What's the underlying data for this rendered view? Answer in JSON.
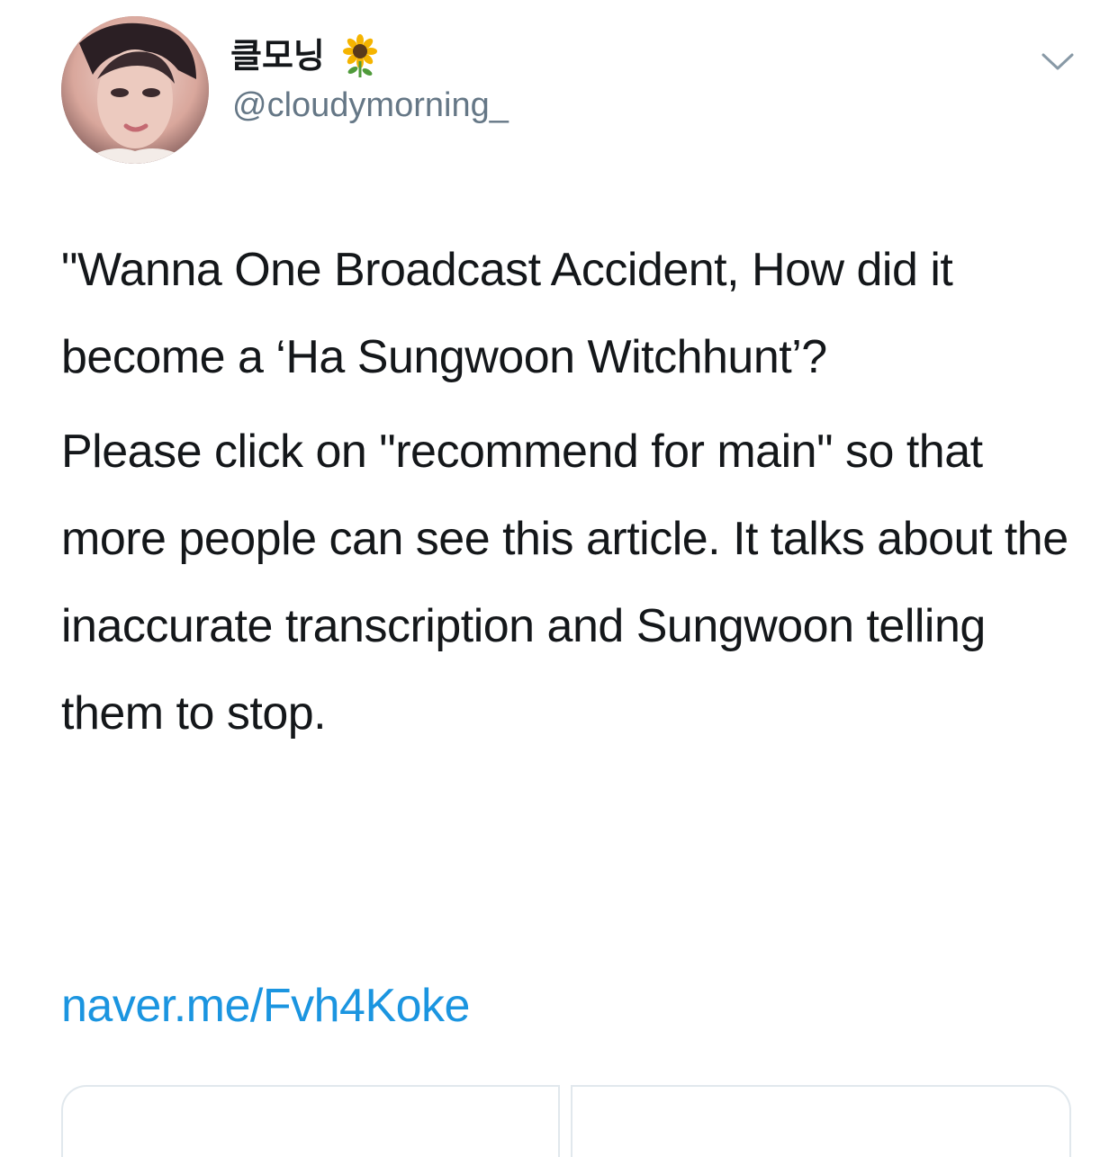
{
  "tweet": {
    "display_name": "클모닝",
    "display_name_emoji_icon": "sunflower-icon",
    "handle": "@cloudymorning_",
    "paragraphs": [
      "\"Wanna One Broadcast Accident, How did it become a ‘Ha Sungwoon Witchhunt’?",
      "Please click on \"recommend for main\" so that more people can see this article. It talks about the inaccurate transcription and Sungwoon telling them to stop."
    ],
    "link_text": "naver.me/Fvh4Koke",
    "menu_icon": "chevron-down-icon"
  },
  "colors": {
    "text": "#14171a",
    "secondary_text": "#657786",
    "link": "#1b95e0",
    "border": "#e1e8ed"
  }
}
